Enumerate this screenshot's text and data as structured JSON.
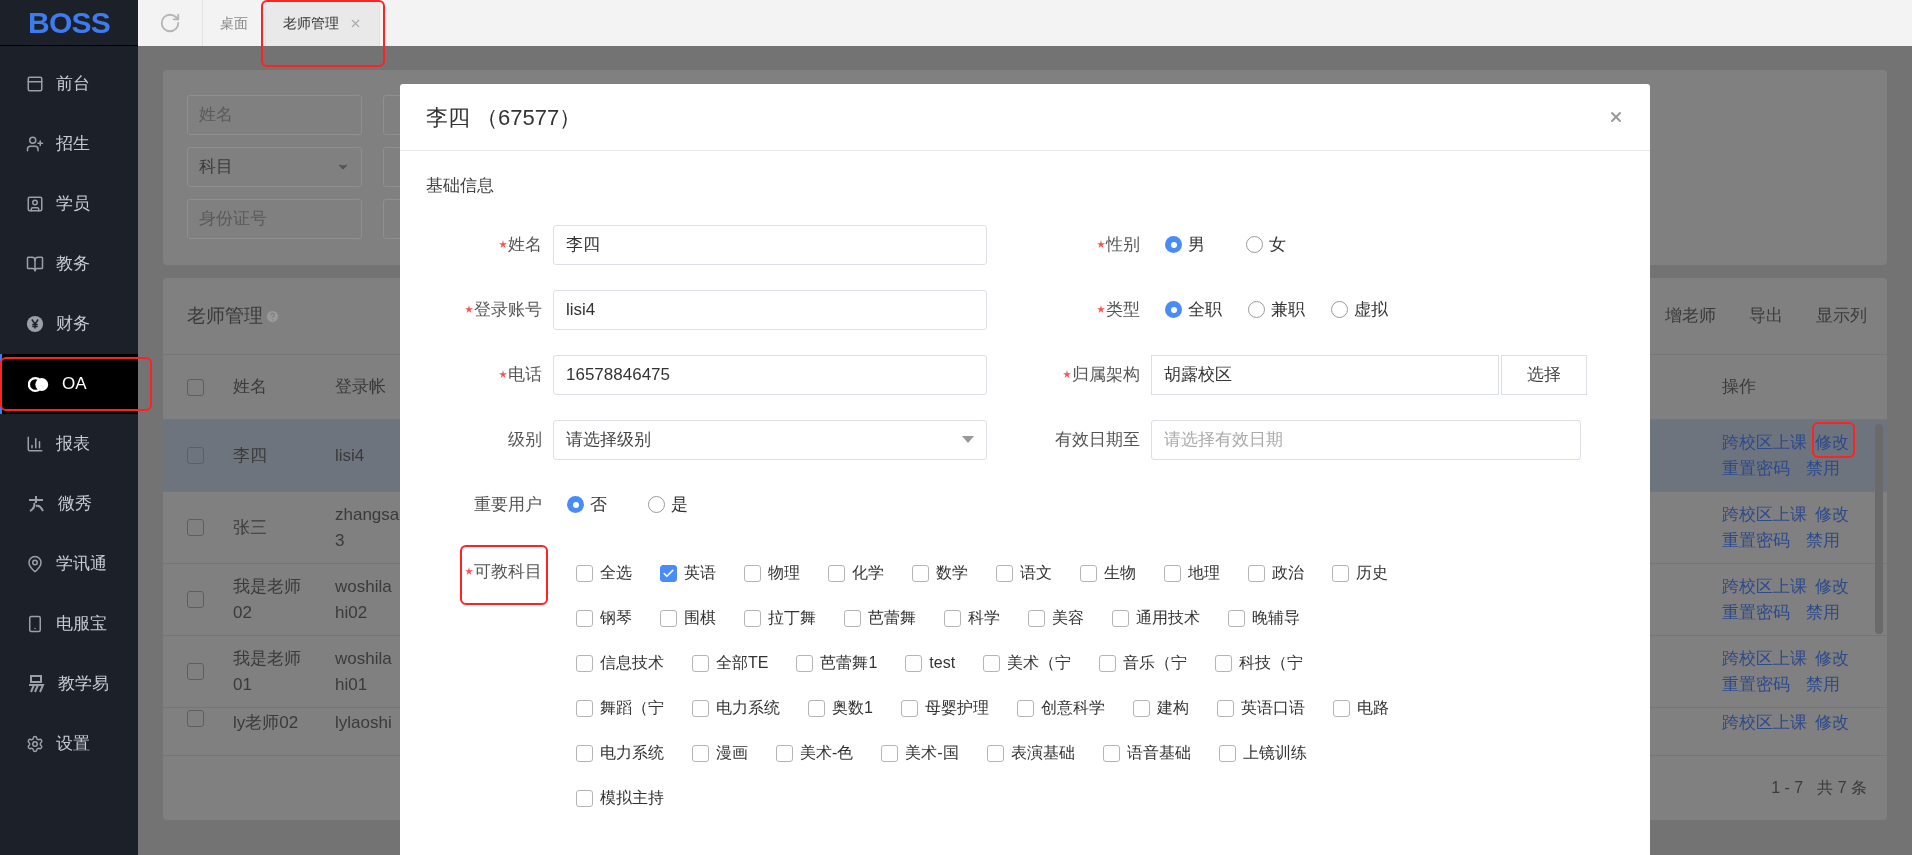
{
  "logo": {
    "text": "BOSS"
  },
  "sidebar": {
    "items": [
      {
        "label": "前台",
        "selected": false,
        "highlighted": false
      },
      {
        "label": "招生",
        "selected": false,
        "highlighted": false
      },
      {
        "label": "学员",
        "selected": false,
        "highlighted": false
      },
      {
        "label": "教务",
        "selected": false,
        "highlighted": false
      },
      {
        "label": "财务",
        "selected": false,
        "highlighted": false
      },
      {
        "label": "OA",
        "selected": true,
        "highlighted": true
      },
      {
        "label": "报表",
        "selected": false,
        "highlighted": false
      },
      {
        "label": "微秀",
        "selected": false,
        "highlighted": false
      },
      {
        "label": "学讯通",
        "selected": false,
        "highlighted": false
      },
      {
        "label": "电服宝",
        "selected": false,
        "highlighted": false
      },
      {
        "label": "教学易",
        "selected": false,
        "highlighted": false
      },
      {
        "label": "设置",
        "selected": false,
        "highlighted": false
      }
    ]
  },
  "tabs": [
    {
      "label": "桌面",
      "selected": false,
      "closable": false,
      "highlighted": false
    },
    {
      "label": "老师管理",
      "selected": true,
      "closable": true,
      "highlighted": true
    }
  ],
  "filters": [
    {
      "kind": "input",
      "placeholder": "姓名"
    },
    {
      "kind": "select",
      "value": "科目"
    },
    {
      "kind": "input",
      "placeholder": "身份证号"
    }
  ],
  "table": {
    "title": "老师管理",
    "actions": [
      "增老师",
      "导出",
      "显示列"
    ],
    "header_checked": false,
    "columns": [
      "姓名",
      "登录帐",
      "操作"
    ],
    "rows": [
      {
        "selected": true,
        "checked": false,
        "name": "李四",
        "login": [
          "lisi4"
        ],
        "ops": [
          {
            "label": "跨校区上课",
            "highlighted": false
          },
          {
            "label": "修改",
            "highlighted": true
          },
          {
            "label": "重置密码",
            "highlighted": false
          },
          {
            "label": "禁用",
            "highlighted": false
          }
        ]
      },
      {
        "selected": false,
        "checked": false,
        "name": "张三",
        "login": [
          "zhangsa",
          "3"
        ],
        "ops": [
          {
            "label": "跨校区上课",
            "highlighted": false
          },
          {
            "label": "修改",
            "highlighted": false
          },
          {
            "label": "重置密码",
            "highlighted": false
          },
          {
            "label": "禁用",
            "highlighted": false
          }
        ]
      },
      {
        "selected": false,
        "checked": false,
        "name": "我是老师02",
        "login": [
          "woshila",
          "hi02"
        ],
        "ops": [
          {
            "label": "跨校区上课",
            "highlighted": false
          },
          {
            "label": "修改",
            "highlighted": false
          },
          {
            "label": "重置密码",
            "highlighted": false
          },
          {
            "label": "禁用",
            "highlighted": false
          }
        ]
      },
      {
        "selected": false,
        "checked": false,
        "name": "我是老师01",
        "login": [
          "woshila",
          "hi01"
        ],
        "ops": [
          {
            "label": "跨校区上课",
            "highlighted": false
          },
          {
            "label": "修改",
            "highlighted": false
          },
          {
            "label": "重置密码",
            "highlighted": false
          },
          {
            "label": "禁用",
            "highlighted": false
          }
        ]
      },
      {
        "selected": false,
        "checked": false,
        "name": "ly老师02",
        "login": [
          "lylaoshi"
        ],
        "ops": [
          {
            "label": "跨校区上课",
            "highlighted": false
          },
          {
            "label": "修改",
            "highlighted": false
          }
        ]
      }
    ],
    "pagination": {
      "range": "1 - 7",
      "total": "共 7 条"
    }
  },
  "dialog": {
    "title": "李四 （67577）",
    "section": "基础信息",
    "left": [
      {
        "label": "姓名",
        "required": true,
        "kind": "input",
        "value": "李四"
      },
      {
        "label": "登录账号",
        "required": true,
        "kind": "input",
        "value": "lisi4"
      },
      {
        "label": "电话",
        "required": true,
        "kind": "input",
        "value": "16578846475"
      },
      {
        "label": "级别",
        "required": false,
        "kind": "select",
        "placeholder": "请选择级别"
      },
      {
        "label": "重要用户",
        "required": false,
        "kind": "radio",
        "options": [
          {
            "label": "否",
            "selected": true
          },
          {
            "label": "是",
            "selected": false
          }
        ]
      }
    ],
    "right": [
      {
        "label": "性别",
        "required": true,
        "kind": "radio",
        "options": [
          {
            "label": "男",
            "selected": true
          },
          {
            "label": "女",
            "selected": false
          }
        ]
      },
      {
        "label": "类型",
        "required": true,
        "kind": "radio",
        "options": [
          {
            "label": "全职",
            "selected": true
          },
          {
            "label": "兼职",
            "selected": false
          },
          {
            "label": "虚拟",
            "selected": false
          }
        ]
      },
      {
        "label": "归属架构",
        "required": true,
        "kind": "picker",
        "value": "胡露校区",
        "button": "选择"
      },
      {
        "label": "有效日期至",
        "required": false,
        "kind": "input",
        "placeholder": "请选择有效日期"
      }
    ],
    "subjects": {
      "label": "可教科目",
      "required": true,
      "highlighted": true,
      "options": [
        {
          "label": "全选",
          "checked": false
        },
        {
          "label": "英语",
          "checked": true
        },
        {
          "label": "物理",
          "checked": false
        },
        {
          "label": "化学",
          "checked": false
        },
        {
          "label": "数学",
          "checked": false
        },
        {
          "label": "语文",
          "checked": false
        },
        {
          "label": "生物",
          "checked": false
        },
        {
          "label": "地理",
          "checked": false
        },
        {
          "label": "政治",
          "checked": false
        },
        {
          "label": "历史",
          "checked": false
        },
        {
          "label": "钢琴",
          "checked": false
        },
        {
          "label": "围棋",
          "checked": false
        },
        {
          "label": "拉丁舞",
          "checked": false
        },
        {
          "label": "芭蕾舞",
          "checked": false
        },
        {
          "label": "科学",
          "checked": false
        },
        {
          "label": "美容",
          "checked": false
        },
        {
          "label": "通用技术",
          "checked": false
        },
        {
          "label": "晚辅导",
          "checked": false
        },
        {
          "label": "信息技术",
          "checked": false
        },
        {
          "label": "全部TE",
          "checked": false
        },
        {
          "label": "芭蕾舞1",
          "checked": false
        },
        {
          "label": "test",
          "checked": false
        },
        {
          "label": "美术（宁",
          "checked": false
        },
        {
          "label": "音乐（宁",
          "checked": false
        },
        {
          "label": "科技（宁",
          "checked": false
        },
        {
          "label": "舞蹈（宁",
          "checked": false
        },
        {
          "label": "电力系统",
          "checked": false
        },
        {
          "label": "奥数1",
          "checked": false
        },
        {
          "label": "母婴护理",
          "checked": false
        },
        {
          "label": "创意科学",
          "checked": false
        },
        {
          "label": "建构",
          "checked": false
        },
        {
          "label": "英语口语",
          "checked": false
        },
        {
          "label": "电路",
          "checked": false
        },
        {
          "label": "电力系统",
          "checked": false
        },
        {
          "label": "漫画",
          "checked": false
        },
        {
          "label": "美术-色",
          "checked": false
        },
        {
          "label": "美术-国",
          "checked": false
        },
        {
          "label": "表演基础",
          "checked": false
        },
        {
          "label": "语音基础",
          "checked": false
        },
        {
          "label": "上镜训练",
          "checked": false
        },
        {
          "label": "模拟主持",
          "checked": false
        }
      ]
    }
  }
}
